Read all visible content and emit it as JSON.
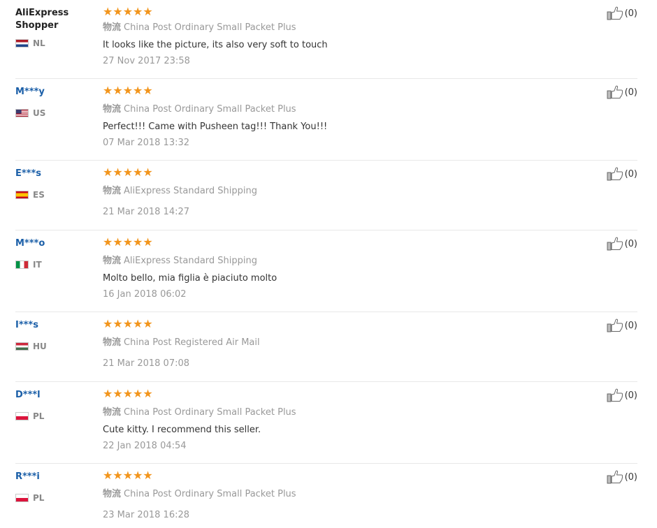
{
  "reviews": [
    {
      "user": "AliExpress Shopper",
      "user_style": "plain",
      "country": "NL",
      "flag": [
        "#ae1c28",
        "#ffffff",
        "#21468b"
      ],
      "stars": "★★★★★",
      "rating": 5,
      "shipping_prefix": "物流",
      "shipping": "China Post Ordinary Small Packet Plus",
      "text": "It looks like the picture, its also very soft to touch",
      "date": "27 Nov 2017 23:58",
      "helpful": "(0)"
    },
    {
      "user": "M***y",
      "user_style": "link",
      "country": "US",
      "flag": "us",
      "stars": "★★★★★",
      "rating": 5,
      "shipping_prefix": "物流",
      "shipping": "China Post Ordinary Small Packet Plus",
      "text": "Perfect!!! Came with Pusheen tag!!! Thank You!!!",
      "date": "07 Mar 2018 13:32",
      "helpful": "(0)"
    },
    {
      "user": "E***s",
      "user_style": "link",
      "country": "ES",
      "flag": [
        "#c60b1e",
        "#ffc400",
        "#c60b1e"
      ],
      "stars": "★★★★★",
      "rating": 5,
      "shipping_prefix": "物流",
      "shipping": "AliExpress Standard Shipping",
      "text": "",
      "date": "21 Mar 2018 14:27",
      "helpful": "(0)"
    },
    {
      "user": "M***o",
      "user_style": "link",
      "country": "IT",
      "flag": "it",
      "stars": "★★★★★",
      "rating": 5,
      "shipping_prefix": "物流",
      "shipping": "AliExpress Standard Shipping",
      "text": "Molto bello, mia figlia è piaciuto molto",
      "date": "16 Jan 2018 06:02",
      "helpful": "(0)"
    },
    {
      "user": "I***s",
      "user_style": "link",
      "country": "HU",
      "flag": [
        "#cd2a3e",
        "#ffffff",
        "#436f4d"
      ],
      "stars": "★★★★★",
      "rating": 5,
      "shipping_prefix": "物流",
      "shipping": "China Post Registered Air Mail",
      "text": "",
      "date": "21 Mar 2018 07:08",
      "helpful": "(0)"
    },
    {
      "user": "D***l",
      "user_style": "link",
      "country": "PL",
      "flag": [
        "#ffffff",
        "#dc143c"
      ],
      "stars": "★★★★★",
      "rating": 5,
      "shipping_prefix": "物流",
      "shipping": "China Post Ordinary Small Packet Plus",
      "text": "Cute kitty. I recommend this seller.",
      "date": "22 Jan 2018 04:54",
      "helpful": "(0)"
    },
    {
      "user": "R***i",
      "user_style": "link",
      "country": "PL",
      "flag": [
        "#ffffff",
        "#dc143c"
      ],
      "stars": "★★★★★",
      "rating": 5,
      "shipping_prefix": "物流",
      "shipping": "China Post Ordinary Small Packet Plus",
      "text": "",
      "date": "23 Mar 2018 16:28",
      "helpful": "(0)"
    }
  ]
}
